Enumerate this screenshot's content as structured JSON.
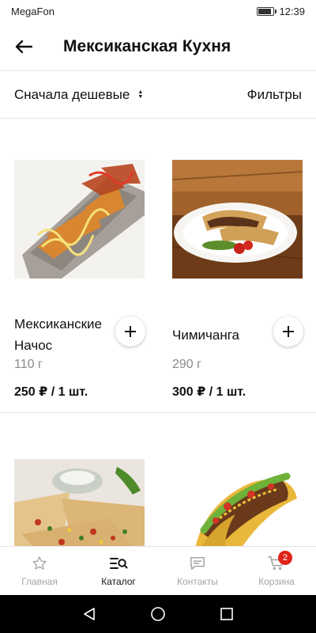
{
  "status_bar": {
    "carrier": "MegaFon",
    "time": "12:39",
    "battery_level": 0.8
  },
  "header": {
    "title": "Мексиканская Кухня",
    "back_icon": "arrow-left-icon"
  },
  "toolbar": {
    "sort_label": "Сначала дешевые",
    "filters_label": "Фильтры"
  },
  "products": [
    {
      "name": "Мексиканские Начос",
      "weight": "110 г",
      "price": "250 ₽ / 1 шт."
    },
    {
      "name": "Чимичанга",
      "weight": "290 г",
      "price": "300 ₽ / 1 шт."
    },
    {
      "name": "",
      "weight": "",
      "price": ""
    },
    {
      "name": "",
      "weight": "",
      "price": ""
    }
  ],
  "bottom_nav": {
    "items": [
      {
        "label": "Главная",
        "icon": "star-icon",
        "active": false
      },
      {
        "label": "Каталог",
        "icon": "catalog-search-icon",
        "active": true
      },
      {
        "label": "Контакты",
        "icon": "chat-icon",
        "active": false
      },
      {
        "label": "Корзина",
        "icon": "cart-icon",
        "active": false,
        "badge": "2"
      }
    ]
  },
  "colors": {
    "accent": "#e0241b",
    "inactive": "#a5a5a5",
    "divider": "#e4e4e4"
  }
}
